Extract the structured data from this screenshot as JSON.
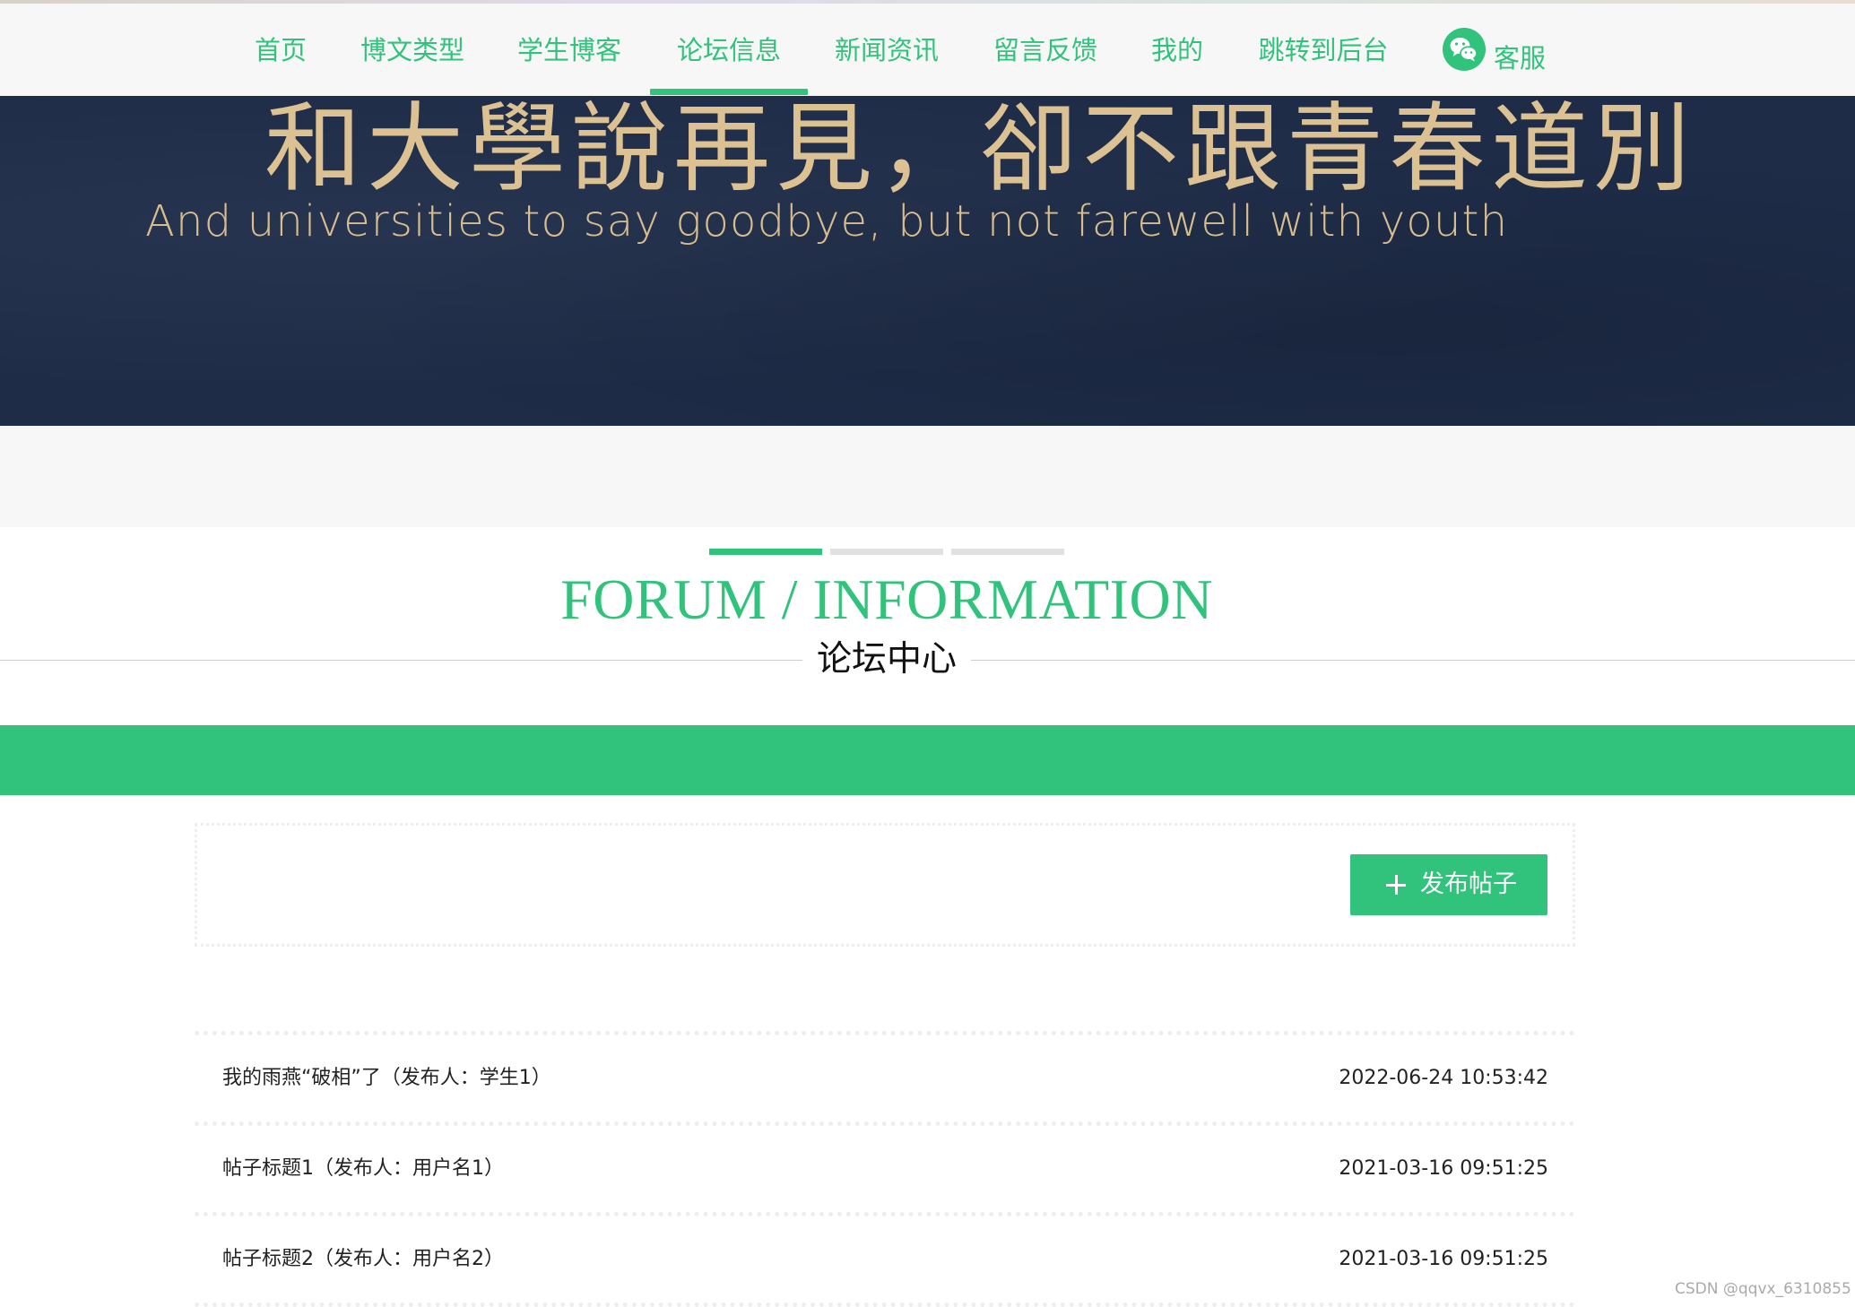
{
  "nav": {
    "items": [
      {
        "label": "首页"
      },
      {
        "label": "博文类型"
      },
      {
        "label": "学生博客"
      },
      {
        "label": "论坛信息"
      },
      {
        "label": "新闻资讯"
      },
      {
        "label": "留言反馈"
      },
      {
        "label": "我的"
      },
      {
        "label": "跳转到后台"
      }
    ],
    "active_index": 3,
    "customer_service_label": "客服",
    "customer_service_icon": "wechat-icon",
    "accent_color": "#31c27c"
  },
  "banner": {
    "headline_cn": "和大學說再見，卻不跟青春道別",
    "headline_en": "And universities to say goodbye, but not farewell with youth"
  },
  "section": {
    "title": "FORUM / INFORMATION",
    "subtitle": "论坛中心"
  },
  "actions": {
    "publish_label": "发布帖子",
    "publish_icon": "plus-icon"
  },
  "posts": [
    {
      "title": "我的雨燕“破相”了（发布人：学生1）",
      "time": "2022-06-24 10:53:42"
    },
    {
      "title": "帖子标题1（发布人：用户名1）",
      "time": "2021-03-16 09:51:25"
    },
    {
      "title": "帖子标题2（发布人：用户名2）",
      "time": "2021-03-16 09:51:25"
    }
  ],
  "watermark": "CSDN @qqvx_6310855"
}
